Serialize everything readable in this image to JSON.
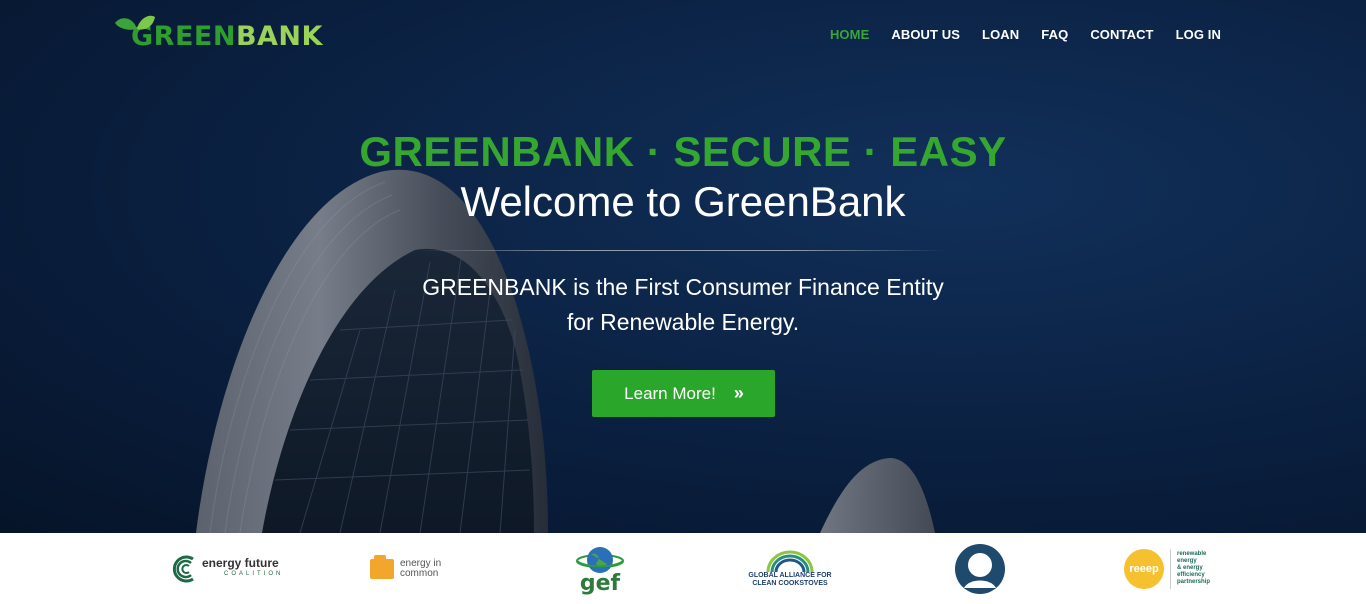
{
  "header": {
    "logo": {
      "part1": "GREEN",
      "part2": "BANK"
    },
    "nav": [
      {
        "label": "HOME",
        "active": true
      },
      {
        "label": "ABOUT US",
        "active": false
      },
      {
        "label": "LOAN",
        "active": false
      },
      {
        "label": "FAQ",
        "active": false
      },
      {
        "label": "CONTACT",
        "active": false
      },
      {
        "label": "LOG IN",
        "active": false
      }
    ]
  },
  "hero": {
    "tagline": "GREENBANK · SECURE · EASY",
    "welcome": "Welcome to GreenBank",
    "desc_line1": "GREENBANK is the First Consumer Finance Entity",
    "desc_line2": "for Renewable Energy.",
    "cta_label": "Learn More!",
    "cta_icon": "double-chevron-right-icon"
  },
  "partners": {
    "energy_future": {
      "name": "energy future",
      "sub": "COALITION"
    },
    "energy_in_common": {
      "line1": "energy in",
      "line2": "common"
    },
    "gef": {
      "name": "gef"
    },
    "global_alliance": {
      "line1": "GLOBAL ALLIANCE FOR",
      "line2": "CLEAN COOKSTOVES"
    },
    "circle_logo": {
      "icon": "person-circle-icon"
    },
    "reeep": {
      "name": "reeep",
      "line1": "renewable",
      "line2": "energy",
      "line3": "& energy",
      "line4": "efficiency",
      "line5": "partnership"
    }
  },
  "colors": {
    "brand_green": "#2aa72a",
    "tagline_green": "#35a62f",
    "nav_active": "#3aa43a",
    "hero_bg": "#0c2447"
  }
}
